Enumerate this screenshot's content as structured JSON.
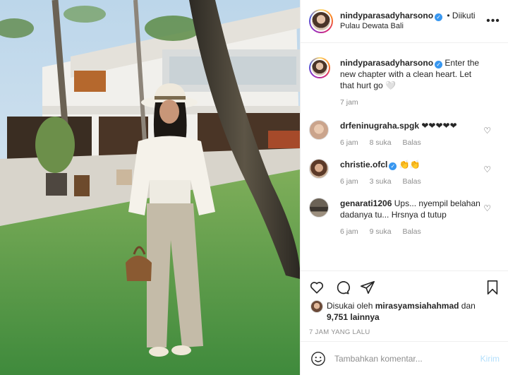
{
  "header": {
    "username": "nindyparasadyharsono",
    "follow_status": "• Diikuti",
    "location": "Pulau Dewata Bali",
    "more_icon": "more-horizontal-icon"
  },
  "caption": {
    "username": "nindyparasadyharsono",
    "text": "Enter the new chapter with a clean heart. Let that hurt go 🤍",
    "time": "7 jam"
  },
  "comments": [
    {
      "username": "drfeninugraha.spgk",
      "text": "❤❤❤❤❤",
      "time": "6 jam",
      "likes": "8 suka",
      "reply": "Balas"
    },
    {
      "username": "christie.ofcl",
      "text": "👏👏",
      "time": "6 jam",
      "likes": "3 suka",
      "reply": "Balas"
    },
    {
      "username": "genarati1206",
      "text": "Ups... nyempil belahan dadanya tu... Hrsnya d tutup",
      "time": "6 jam",
      "likes": "9 suka",
      "reply": "Balas"
    }
  ],
  "likes": {
    "prefix": "Disukai oleh",
    "user": "mirasyamsiahahmad",
    "and": "dan",
    "others": "9,751 lainnya"
  },
  "timestamp": "7 JAM YANG LALU",
  "add_comment": {
    "placeholder": "Tambahkan komentar...",
    "post_label": "Kirim"
  },
  "colors": {
    "verified": "#3897f0",
    "muted": "#8e8e8e",
    "post_button": "#b2dffc"
  }
}
